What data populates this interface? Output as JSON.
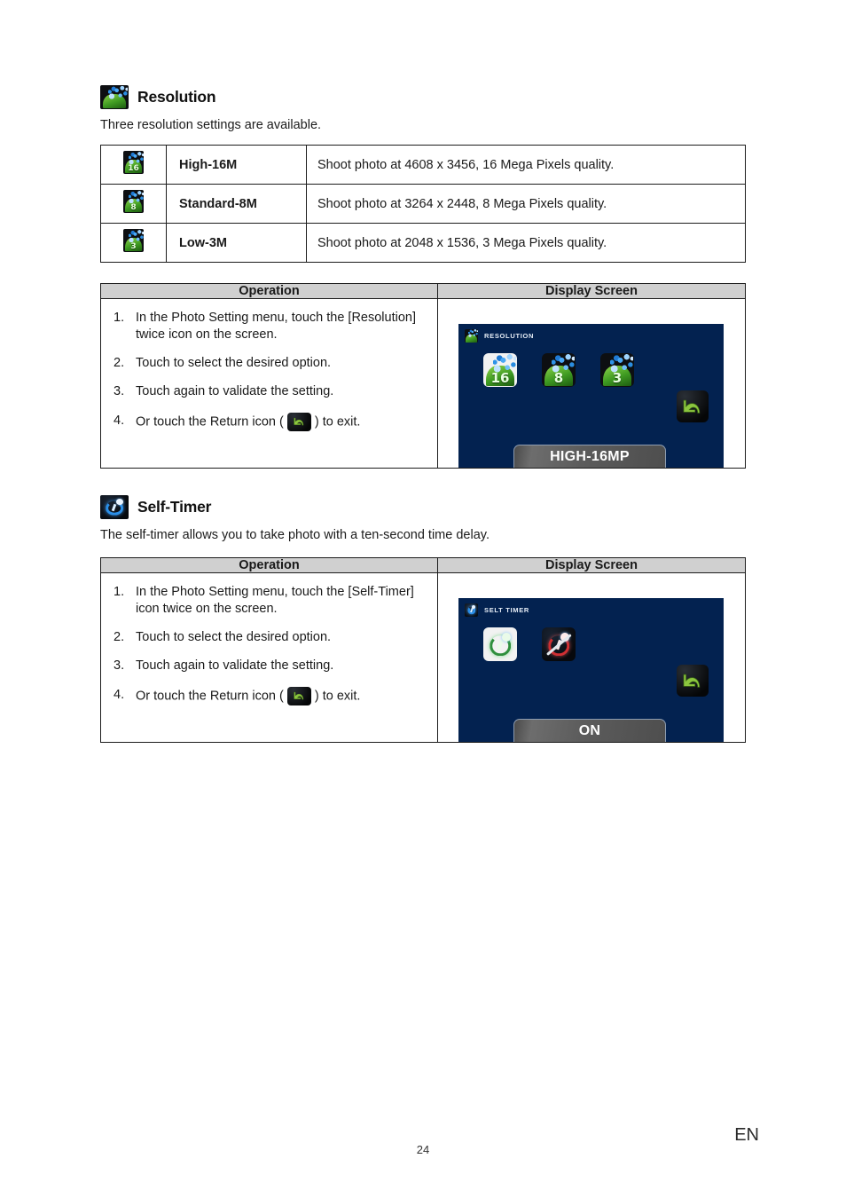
{
  "document": {
    "page_number": "24",
    "language_code": "EN"
  },
  "sections": [
    {
      "id": "resolution",
      "icon": "resolution-icon",
      "title": "Resolution",
      "description": "Three resolution settings are available.",
      "options_table": {
        "rows": [
          {
            "icon": "resolution-high-icon",
            "icon_badge": "16",
            "name": "High-16M",
            "desc": "Shoot photo at 4608 x 3456, 16 Mega Pixels quality."
          },
          {
            "icon": "resolution-standard-icon",
            "icon_badge": "8",
            "name": "Standard-8M",
            "desc": "Shoot photo at 3264 x 2448, 8 Mega Pixels quality."
          },
          {
            "icon": "resolution-low-icon",
            "icon_badge": "3",
            "name": "Low-3M",
            "desc": "Shoot photo at 2048 x 1536, 3 Mega Pixels quality."
          }
        ]
      },
      "operation_table": {
        "headers": {
          "operation": "Operation",
          "display_screen": "Display Screen"
        },
        "steps": [
          {
            "num": "1.",
            "text": "In the Photo Setting menu, touch the [Resolution] twice icon on the screen."
          },
          {
            "num": "2.",
            "text": "Touch to select the desired option."
          },
          {
            "num": "3.",
            "text": "Touch again to validate the setting."
          },
          {
            "num": "4.",
            "text_before": "Or touch the Return icon (",
            "text_after": ") to exit.",
            "icon": "return-icon"
          }
        ],
        "screen": {
          "title": "RESOLUTION",
          "title_icon": "resolution-icon",
          "background_color": "#032250",
          "options": [
            {
              "badge": "16",
              "selected": true
            },
            {
              "badge": "8",
              "selected": false
            },
            {
              "badge": "3",
              "selected": false
            }
          ],
          "return_icon": "return-icon",
          "label": "HIGH-16MP"
        }
      }
    },
    {
      "id": "self-timer",
      "icon": "self-timer-icon",
      "title": "Self-Timer",
      "description": "The self-timer allows you to take photo with a ten-second time delay.",
      "operation_table": {
        "headers": {
          "operation": "Operation",
          "display_screen": "Display Screen"
        },
        "steps": [
          {
            "num": "1.",
            "text": "In the Photo Setting menu, touch the [Self-Timer] icon twice on the screen."
          },
          {
            "num": "2.",
            "text": "Touch to select the desired option."
          },
          {
            "num": "3.",
            "text": "Touch again to validate the setting."
          },
          {
            "num": "4.",
            "text_before": "Or touch the Return icon (",
            "text_after": ") to exit.",
            "icon": "return-icon"
          }
        ],
        "screen": {
          "title": "SELT TIMER",
          "title_icon": "self-timer-icon",
          "background_color": "#032250",
          "options": [
            {
              "state": "on",
              "selected": true
            },
            {
              "state": "off",
              "selected": false
            }
          ],
          "return_icon": "return-icon",
          "label": "ON"
        }
      }
    }
  ],
  "colors": {
    "screen_navy": "#032250",
    "table_header_gray": "#d0d0d0",
    "border_black": "#1c1c1c"
  }
}
